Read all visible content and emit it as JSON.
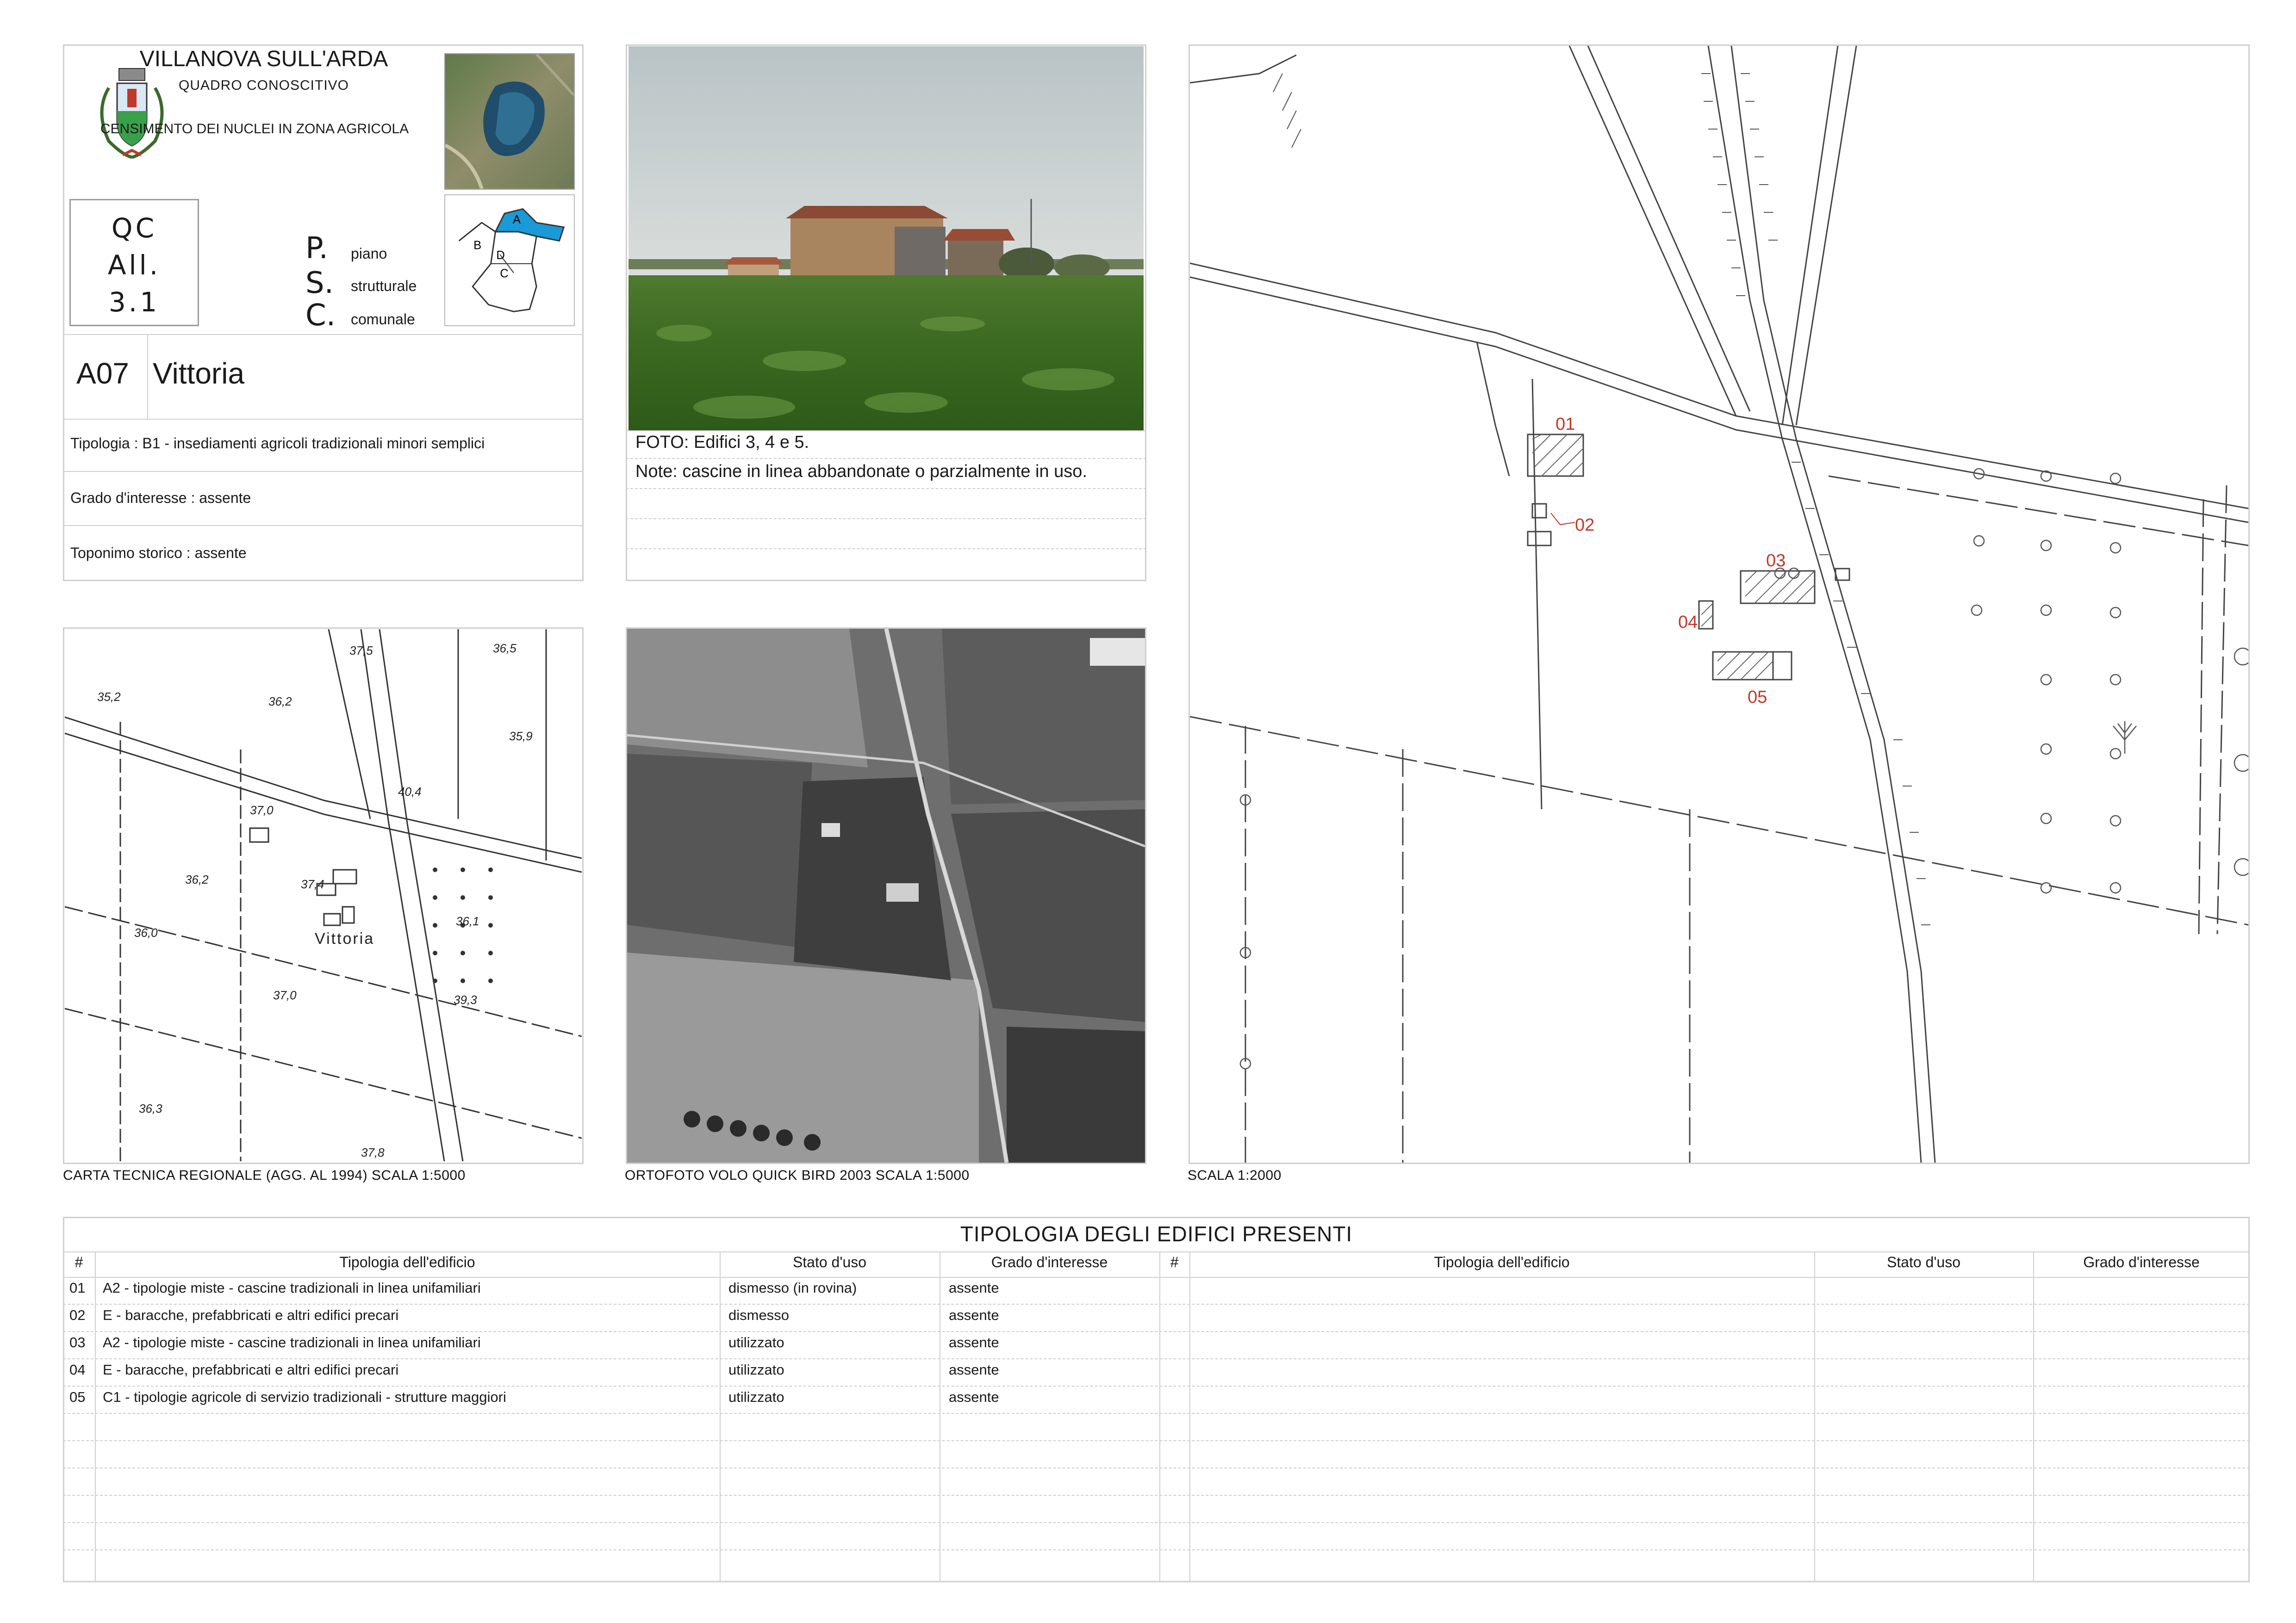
{
  "header": {
    "municipality": "VILLANOVA SULL'ARDA",
    "subtitle": "QUADRO CONOSCITIVO",
    "census_title": "CENSIMENTO DEI NUCLEI IN ZONA AGRICOLA",
    "doc_code_lines": [
      "QC",
      "All.",
      "3.1"
    ],
    "psc": [
      {
        "letter": "P.",
        "word": "piano"
      },
      {
        "letter": "S.",
        "word": "strutturale"
      },
      {
        "letter": "C.",
        "word": "comunale"
      }
    ],
    "zone_map_labels": [
      "A",
      "B",
      "C",
      "D"
    ]
  },
  "record": {
    "code": "A07",
    "name": "Vittoria",
    "tipologia": "Tipologia : B1 - insediamenti agricoli tradizionali minori semplici",
    "grado": "Grado d'interesse : assente",
    "toponimo": "Toponimo storico : assente"
  },
  "photo": {
    "caption": "FOTO: Edifici 3, 4 e 5.",
    "note": "Note: cascine in linea abbandonate o parzialmente in uso."
  },
  "maps": {
    "ctr_caption": "CARTA TECNICA REGIONALE (AGG. AL 1994) SCALA 1:5000",
    "ortho_caption": "ORTOFOTO VOLO QUICK BIRD 2003 SCALA 1:5000",
    "plan_caption": "SCALA 1:2000",
    "ctr_labels": [
      "37,5",
      "36,5",
      "35,2",
      "36,2",
      "35,9",
      "40,4",
      "37,0",
      "37,4",
      "36,2",
      "36,1",
      "36,0",
      "Vittoria",
      "37,0",
      "39,3",
      "36,3",
      "37,8"
    ],
    "plan_building_labels": [
      "01",
      "02",
      "03",
      "04",
      "05"
    ]
  },
  "table": {
    "title": "TIPOLOGIA DEGLI EDIFICI PRESENTI",
    "headers": [
      "#",
      "Tipologia dell'edificio",
      "Stato d'uso",
      "Grado d'interesse"
    ],
    "rows": [
      {
        "n": "01",
        "tipologia": "A2 - tipologie miste - cascine tradizionali in linea unifamiliari",
        "stato": "dismesso (in rovina)",
        "grado": "assente"
      },
      {
        "n": "02",
        "tipologia": "E - baracche, prefabbricati e altri edifici precari",
        "stato": "dismesso",
        "grado": "assente"
      },
      {
        "n": "03",
        "tipologia": "A2 - tipologie miste - cascine tradizionali in linea unifamiliari",
        "stato": "utilizzato",
        "grado": "assente"
      },
      {
        "n": "04",
        "tipologia": "E - baracche, prefabbricati e altri edifici precari",
        "stato": "utilizzato",
        "grado": "assente"
      },
      {
        "n": "05",
        "tipologia": "C1 - tipologie agricole di servizio tradizionali - strutture maggiori",
        "stato": "utilizzato",
        "grado": "assente"
      }
    ]
  },
  "colors": {
    "frame": "#cfcfcf",
    "building_label": "#c0392b",
    "zone_highlight": "#1a9ad6"
  }
}
